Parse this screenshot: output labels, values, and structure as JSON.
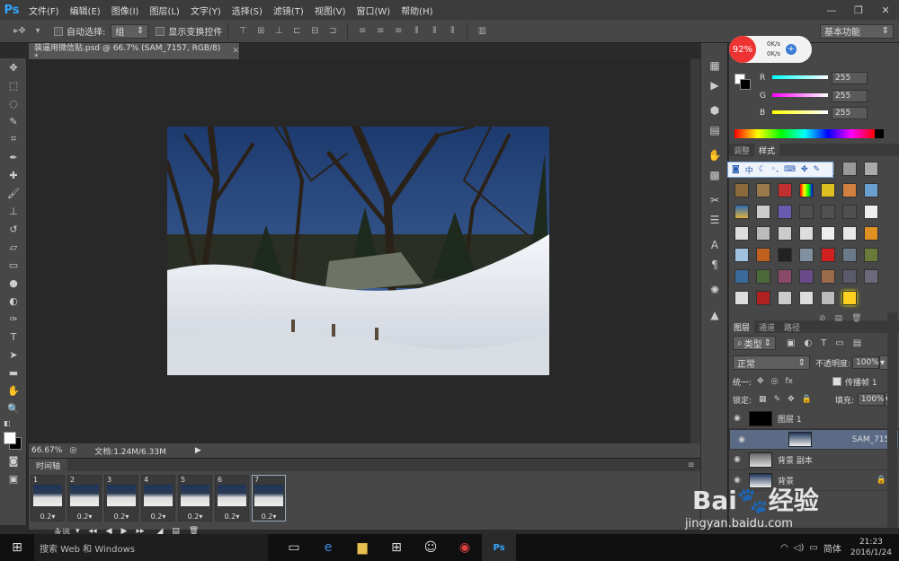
{
  "app": {
    "logo": "Ps"
  },
  "menu": [
    "文件(F)",
    "编辑(E)",
    "图像(I)",
    "图层(L)",
    "文字(Y)",
    "选择(S)",
    "滤镜(T)",
    "视图(V)",
    "窗口(W)",
    "帮助(H)"
  ],
  "window_controls": {
    "minimize": "—",
    "restore": "❐",
    "close": "✕"
  },
  "options": {
    "auto_select_label": "自动选择:",
    "auto_select_value": "组",
    "show_transform_label": "显示变换控件",
    "workspace": "基本功能"
  },
  "document": {
    "tab_title": "装逼用微信贴.psd @ 66.7% (SAM_7157, RGB/8) *",
    "zoom": "66.67%",
    "doc_size": "文档:1.24M/6.33M"
  },
  "timeline": {
    "tab_label": "时间轴",
    "frames": [
      {
        "num": "1",
        "delay": "0.2▾"
      },
      {
        "num": "2",
        "delay": "0.2▾"
      },
      {
        "num": "3",
        "delay": "0.2▾"
      },
      {
        "num": "4",
        "delay": "0.2▾"
      },
      {
        "num": "5",
        "delay": "0.2▾"
      },
      {
        "num": "6",
        "delay": "0.2▾"
      },
      {
        "num": "7",
        "delay": "0.2▾"
      }
    ],
    "loop": "永远"
  },
  "speed_widget": {
    "percent": "92%",
    "up": "0K/s",
    "down": "0K/s"
  },
  "color_panel": {
    "r_label": "R",
    "g_label": "G",
    "b_label": "B",
    "r": "255",
    "g": "255",
    "b": "255"
  },
  "styles_panel": {
    "tab_adjust": "调整",
    "tab_styles": "样式"
  },
  "ime_bar": {
    "mode": "中"
  },
  "layers_panel": {
    "tabs": [
      "图层",
      "通道",
      "路径"
    ],
    "filter": "类型",
    "blend": "正常",
    "opacity_label": "不透明度:",
    "opacity": "100%",
    "unify_label": "统一:",
    "propagate_label": "传播帧 1",
    "lock_label": "锁定:",
    "fill_label": "填充:",
    "fill": "100%",
    "layers": [
      {
        "name": "图层 1"
      },
      {
        "name": "SAM_7157"
      },
      {
        "name": "背景 副本"
      },
      {
        "name": "背景"
      }
    ]
  },
  "taskbar": {
    "search": "搜索 Web 和 Windows",
    "ime": "简体",
    "time": "21:23",
    "date": "2016/1/24"
  },
  "watermark": {
    "brand": "Bai",
    "brand2": "经验",
    "url": "jingyan.baidu.com"
  }
}
